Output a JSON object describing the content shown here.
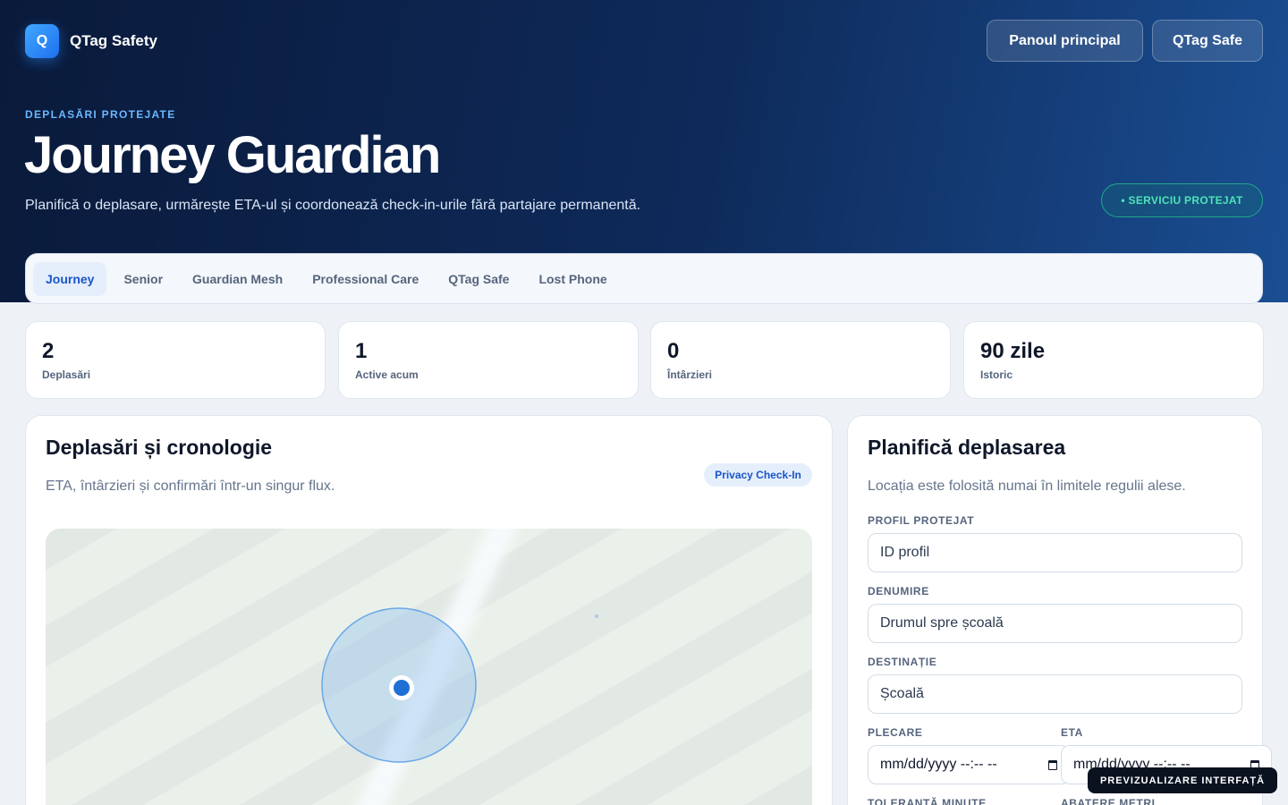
{
  "brand": {
    "logo_letter": "Q",
    "name": "QTag Safety"
  },
  "nav": {
    "dashboard_label": "Panoul principal",
    "safe_label": "QTag Safe"
  },
  "hero": {
    "eyebrow": "DEPLASĂRI PROTEJATE",
    "title": "Journey Guardian",
    "subtitle": "Planifică o deplasare, urmărește ETA-ul și coordonează check-in-urile fără partajare permanentă.",
    "status_pill": "• SERVICIU PROTEJAT"
  },
  "tabs": [
    {
      "label": "Journey",
      "active": true
    },
    {
      "label": "Senior"
    },
    {
      "label": "Guardian Mesh"
    },
    {
      "label": "Professional Care"
    },
    {
      "label": "QTag Safe"
    },
    {
      "label": "Lost Phone"
    }
  ],
  "stats": [
    {
      "value": "2",
      "label": "Deplasări"
    },
    {
      "value": "1",
      "label": "Active acum"
    },
    {
      "value": "0",
      "label": "Întârzieri"
    },
    {
      "value": "90 zile",
      "label": "Istoric"
    }
  ],
  "timeline": {
    "title": "Deplasări și cronologie",
    "description": "ETA, întârzieri și confirmări într-un singur flux.",
    "badge": "Privacy Check-In"
  },
  "planner": {
    "title": "Planifică deplasarea",
    "description": "Locația este folosită numai în limitele regulii alese.",
    "profile_label": "PROFIL PROTEJAT",
    "profile_placeholder": "ID profil",
    "name_label": "DENUMIRE",
    "name_placeholder": "Drumul spre școală",
    "destination_label": "DESTINAȚIE",
    "destination_placeholder": "Școală",
    "departure_label": "PLECARE",
    "departure_value": "mm/dd/yyyy --:-- --",
    "eta_label": "ETA",
    "eta_value": "mm/dd/yyyy --:-- --",
    "tolerance_label": "TOLERANȚĂ MINUTE",
    "deviation_label": "ABATERE METRI"
  },
  "preview_tag": "PREVIZUALIZARE INTERFAȚĂ",
  "icons": {
    "calendar": "calendar-icon",
    "location": "location-dot-icon"
  },
  "colors": {
    "hero_start": "#0a1a3a",
    "hero_end": "#1a4e92",
    "accent": "#1a55c8",
    "logo": "#3fa9ff",
    "protected": "#4de3b8",
    "location_dot": "#1f6fd6"
  }
}
